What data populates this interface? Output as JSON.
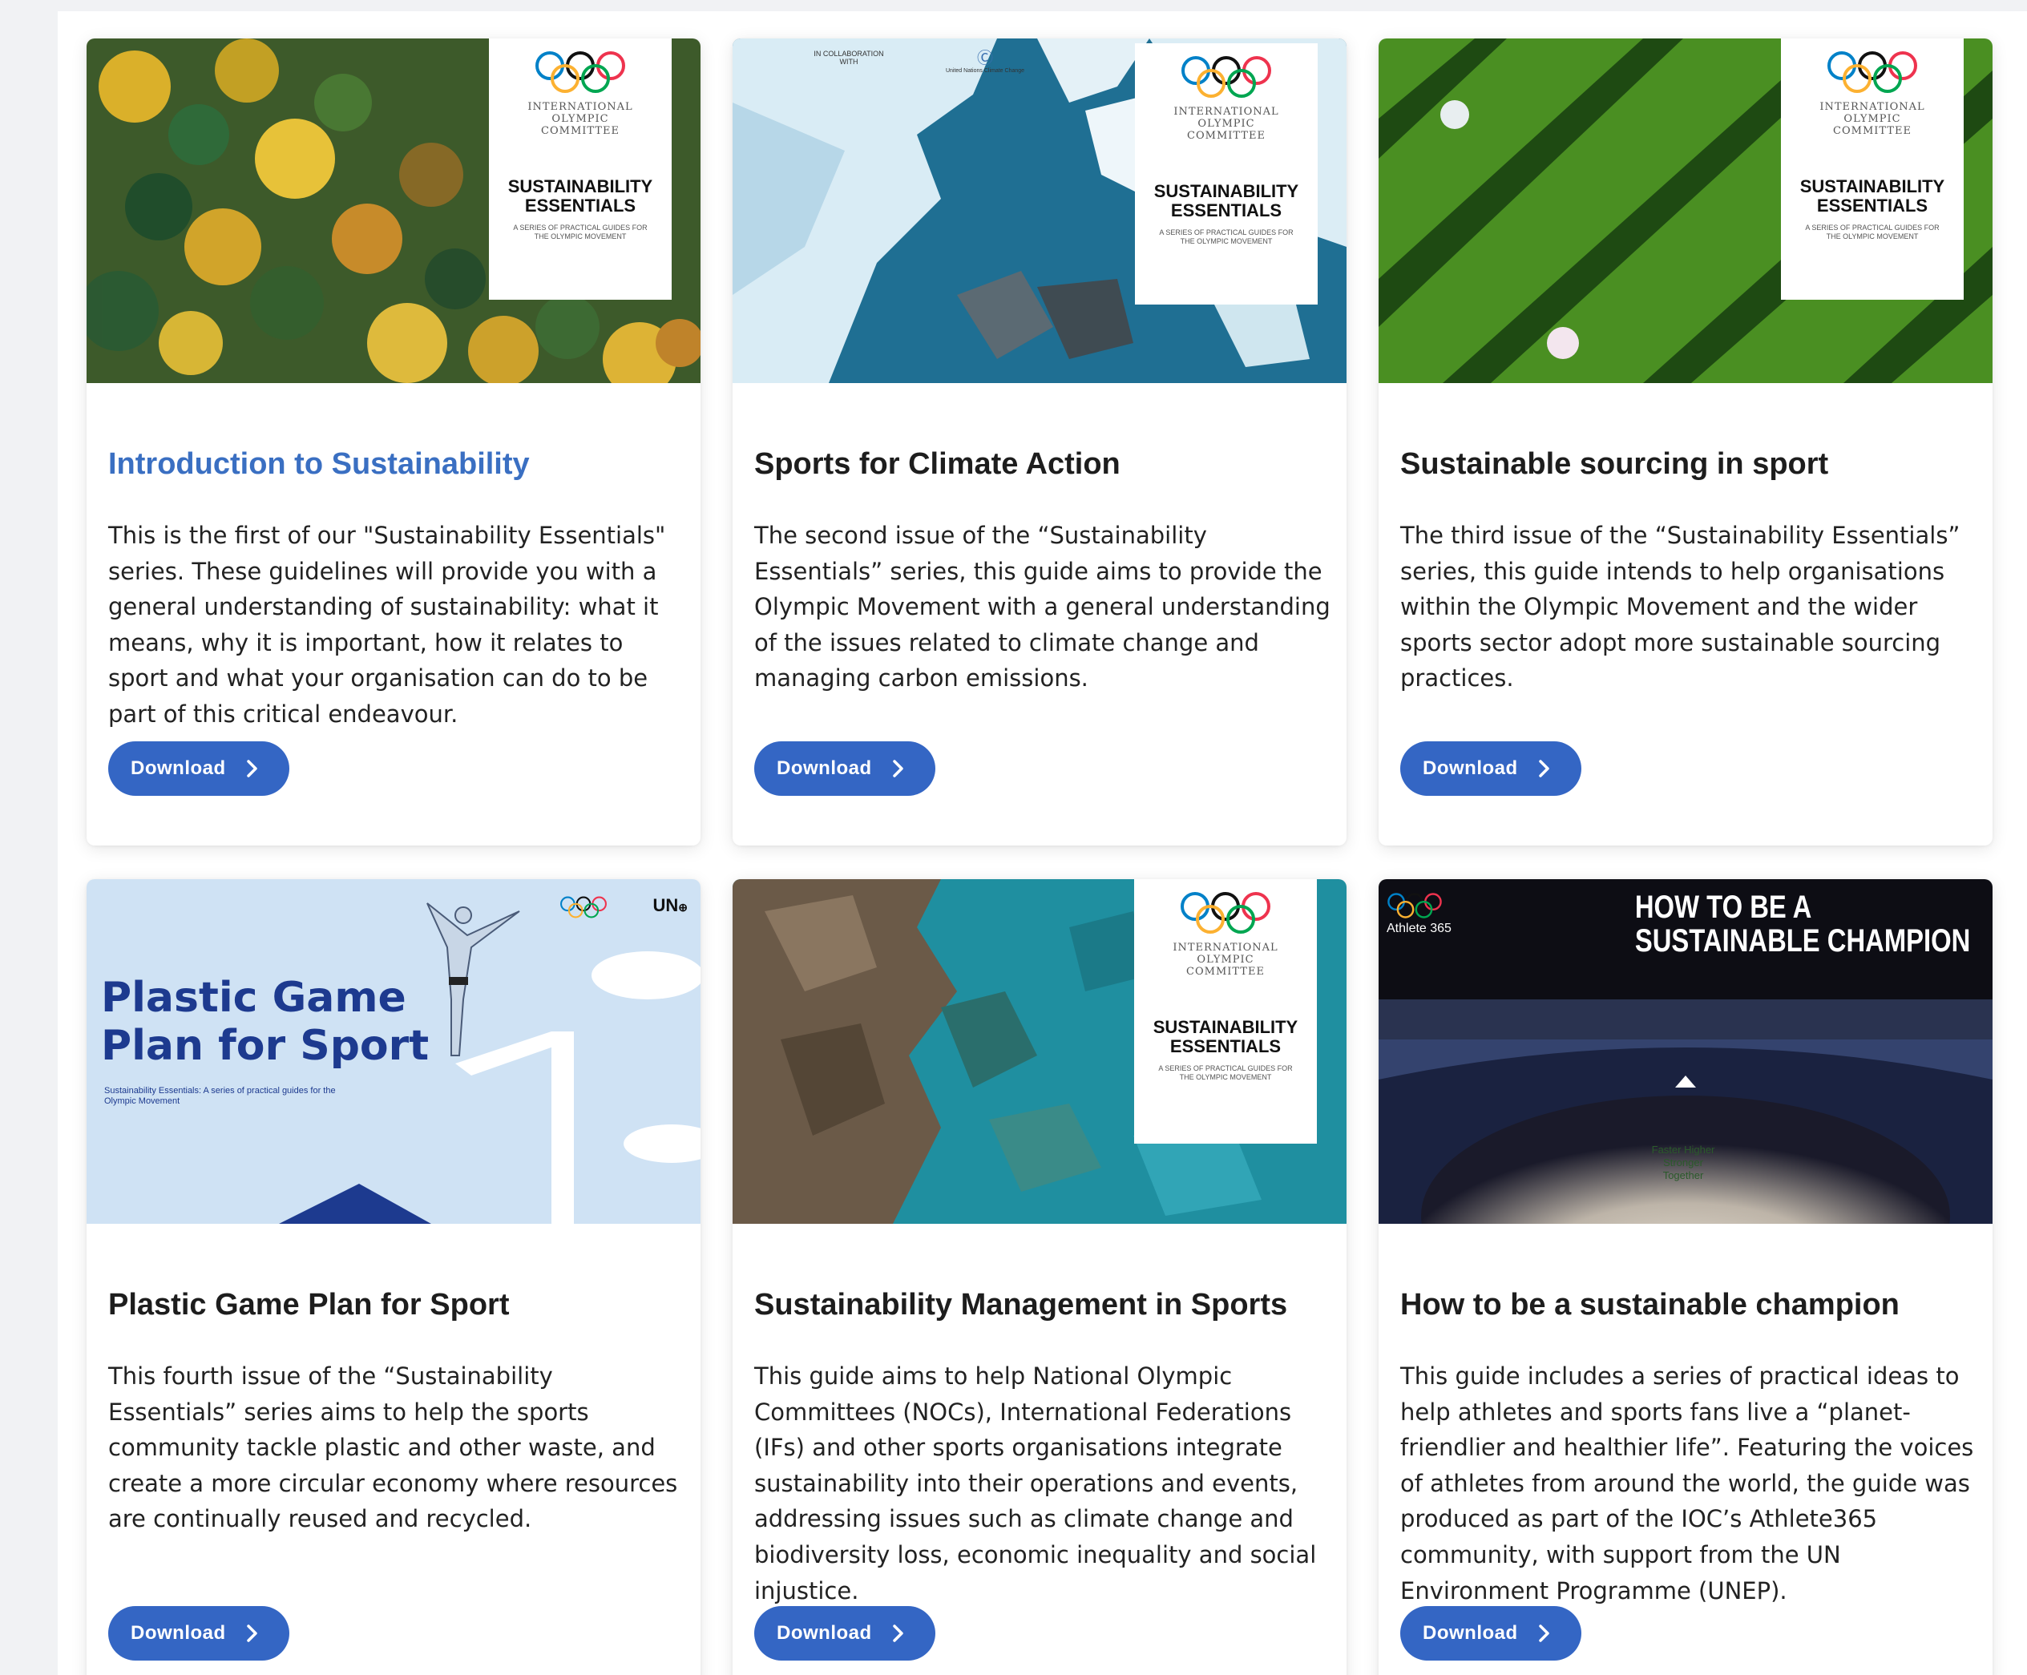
{
  "cover": {
    "org_name": "INTERNATIONAL OLYMPIC COMMITTEE",
    "series": "SUSTAINABILITY ESSENTIALS",
    "sub": "A SERIES OF PRACTICAL GUIDES FOR THE OLYMPIC MOVEMENT"
  },
  "colors": {
    "accent": "#3466c4",
    "link_title": "#3a6fc2",
    "background": "#f1f2f4"
  },
  "cards": [
    {
      "title": "Introduction to Sustainability",
      "description": "This is the first of our \"Sustainability Essentials\" series. These guidelines will provide you with a general understanding of sustainability: what it means, why it is important, how it relates to sport and what your organisation can do to be part of this critical endeavour.",
      "button": "Download",
      "image": "forest-aerial"
    },
    {
      "title": "Sports for Climate Action",
      "description": "The second issue of the “Sustainability Essentials” series, this guide aims to provide the Olympic Movement with a general understanding of the issues related to climate change and managing carbon emissions.",
      "button": "Download",
      "image": "glacier-aerial",
      "collab_text": "IN COLLABORATION WITH",
      "partner": "United Nations Climate Change"
    },
    {
      "title": "Sustainable sourcing in sport",
      "description": "The third issue of the “Sustainability Essentials” series, this guide intends to help organisations within the Olympic Movement and the wider sports sector adopt more sustainable sourcing practices.",
      "button": "Download",
      "image": "crop-rows-aerial"
    },
    {
      "title": "Plastic Game Plan for Sport",
      "description": "This fourth issue of the “Sustainability Essentials” series aims to help the sports community tackle plastic and other waste, and create a more circular economy where resources are continually reused and recycled.",
      "button": "Download",
      "image": "diver-illustration",
      "cover_title": "Plastic Game\nPlan for Sport",
      "cover_sub": "Sustainability Essentials: A series of practical guides for the Olympic Movement",
      "partner": "UN environment programme"
    },
    {
      "title": "Sustainability Management in Sports",
      "description": "This guide aims to help National Olympic Committees (NOCs), International Federations (IFs) and other sports organisations integrate sustainability into their operations and events, addressing issues such as climate change and biodiversity loss, economic inequality and social injustice.",
      "button": "Download",
      "image": "coastline-aerial"
    },
    {
      "title": "How to be a sustainable champion",
      "description": "This guide includes a series of practical ideas to help athletes and sports fans live a “planet-friendlier and healthier life”. Featuring the voices of athletes from around the world, the guide was produced as part of the IOC’s Athlete365 community, with support from the UN Environment Programme (UNEP).",
      "button": "Download",
      "image": "stadium-night",
      "cover_title": "HOW TO BE A\nSUSTAINABLE CHAMPION",
      "brand": "Athlete 365",
      "motto": "Faster Higher Stronger Together"
    }
  ]
}
